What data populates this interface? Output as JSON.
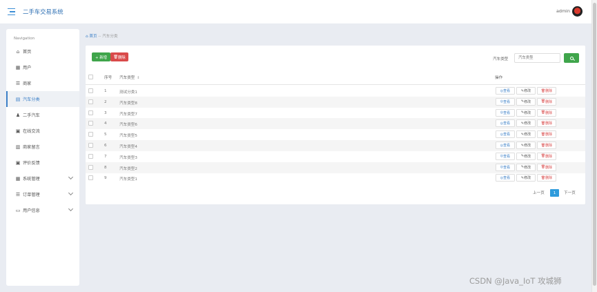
{
  "header": {
    "app_title": "二手车交易系统",
    "user_name": "admin"
  },
  "sidebar": {
    "nav_title": "Navigation",
    "items": [
      {
        "label": "首页",
        "icon": "home-icon",
        "glyph": "⌂"
      },
      {
        "label": "用户",
        "icon": "grid-icon",
        "glyph": "▦"
      },
      {
        "label": "商家",
        "icon": "sliders-icon",
        "glyph": "☰"
      },
      {
        "label": "汽车分类",
        "icon": "category-icon",
        "glyph": "▤",
        "active": true
      },
      {
        "label": "二手汽车",
        "icon": "person-icon",
        "glyph": "♟"
      },
      {
        "label": "在线交流",
        "icon": "chat-icon",
        "glyph": "▣"
      },
      {
        "label": "商家留言",
        "icon": "message-icon",
        "glyph": "▥"
      },
      {
        "label": "评价反馈",
        "icon": "feedback-icon",
        "glyph": "▣"
      },
      {
        "label": "系统管理",
        "icon": "system-icon",
        "glyph": "▦",
        "expandable": true
      },
      {
        "label": "订单管理",
        "icon": "list-icon",
        "glyph": "☰",
        "expandable": true
      },
      {
        "label": "用户信息",
        "icon": "profile-icon",
        "glyph": "▭",
        "expandable": true
      }
    ]
  },
  "breadcrumb": {
    "home": "首页",
    "separator": "--",
    "current": "汽车分类"
  },
  "toolbar": {
    "add_label": "+ 新增",
    "delete_label": "删除",
    "search_label": "汽车类型",
    "search_placeholder": "汽车类型"
  },
  "table": {
    "columns": {
      "index": "序号",
      "type": "汽车类型",
      "actions": "操作"
    },
    "rows": [
      {
        "index": "1",
        "type": "测试分类1"
      },
      {
        "index": "2",
        "type": "汽车类型8"
      },
      {
        "index": "3",
        "type": "汽车类型7"
      },
      {
        "index": "4",
        "type": "汽车类型6"
      },
      {
        "index": "5",
        "type": "汽车类型5"
      },
      {
        "index": "6",
        "type": "汽车类型4"
      },
      {
        "index": "7",
        "type": "汽车类型3"
      },
      {
        "index": "8",
        "type": "汽车类型2"
      },
      {
        "index": "9",
        "type": "汽车类型1"
      }
    ],
    "actions": {
      "view": "查看",
      "edit": "修改",
      "remove": "删除"
    }
  },
  "pagination": {
    "prev": "上一页",
    "current": "1",
    "next": "下一页"
  },
  "watermark": "CSDN @Java_IoT 攻城狮",
  "colors": {
    "accent": "#3b7fc7",
    "success": "#3fa54b",
    "danger": "#d94a4a",
    "page_active": "#2e9bdc"
  }
}
